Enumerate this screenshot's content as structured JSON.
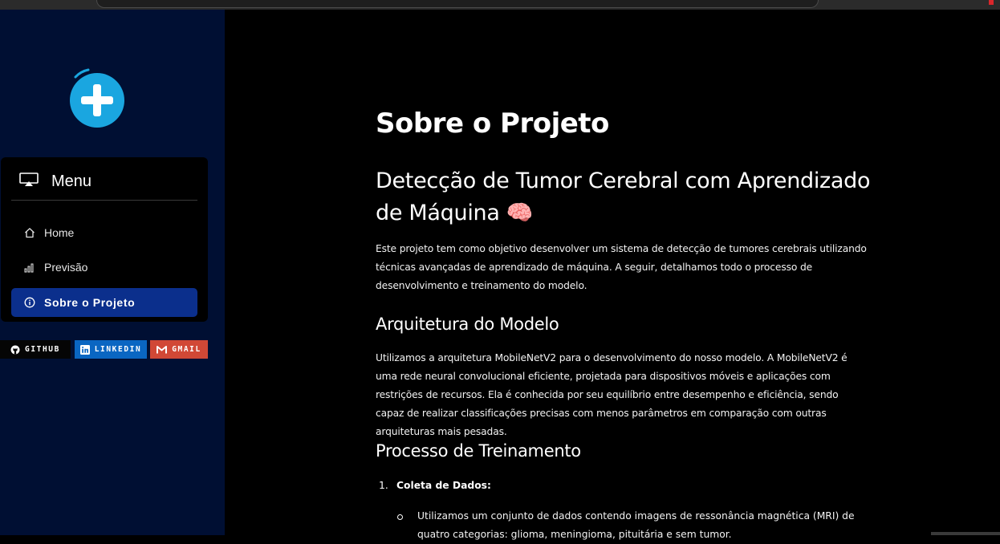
{
  "sidebar": {
    "menu_title": "Menu",
    "items": [
      {
        "label": "Home",
        "icon": "house-icon"
      },
      {
        "label": "Previsão",
        "icon": "bar-chart-icon"
      },
      {
        "label": "Sobre o Projeto",
        "icon": "info-circle-icon",
        "active": true
      }
    ],
    "badges": [
      {
        "label": "GITHUB",
        "icon": "github-icon",
        "color": "#050505"
      },
      {
        "label": "LINKEDIN",
        "icon": "linkedin-icon",
        "color": "#0a66c2"
      },
      {
        "label": "GMAIL",
        "icon": "gmail-icon",
        "color": "#d14836"
      }
    ],
    "accent": "#0b2f8c",
    "background": "#000f33"
  },
  "main": {
    "page_title": "Sobre o Projeto",
    "heading": "Detecção de Tumor Cerebral com Aprendizado de Máquina 🧠",
    "intro": "Este projeto tem como objetivo desenvolver um sistema de detecção de tumores cerebrais utilizando técnicas avançadas de aprendizado de máquina. A seguir, detalhamos todo o processo de desenvolvimento e treinamento do modelo.",
    "section_architecture": {
      "title": "Arquitetura do Modelo",
      "text": "Utilizamos a arquitetura MobileNetV2 para o desenvolvimento do nosso modelo. A MobileNetV2 é uma rede neural convolucional eficiente, projetada para dispositivos móveis e aplicações com restrições de recursos. Ela é conhecida por seu equilíbrio entre desempenho e eficiência, sendo capaz de realizar classificações precisas com menos parâmetros em comparação com outras arquiteturas mais pesadas."
    },
    "section_training": {
      "title": "Processo de Treinamento",
      "steps": [
        {
          "number": "1.",
          "title": "Coleta de Dados:",
          "bullets": [
            "Utilizamos um conjunto de dados contendo imagens de ressonância magnética (MRI) de quatro categorias: glioma, meningioma, pituitária e sem tumor."
          ]
        }
      ]
    }
  }
}
